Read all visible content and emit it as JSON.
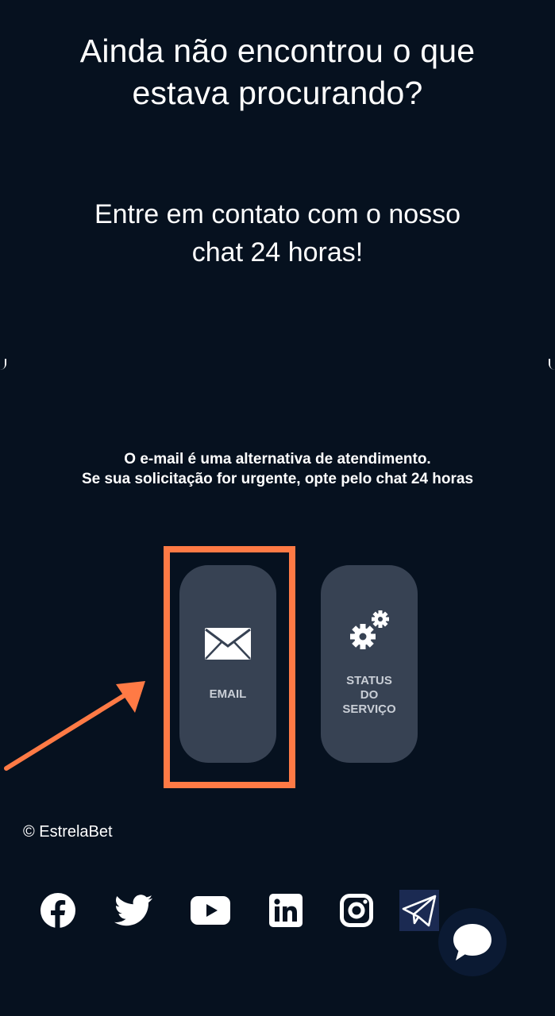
{
  "hero": {
    "title": "Ainda não encontrou o que estava procurando?",
    "subtitle": "Entre em contato com o nosso chat 24 horas!"
  },
  "notice": {
    "line1": "O e-mail é uma alternativa de atendimento.",
    "line2": "Se sua solicitação for urgente, opte pelo chat 24 horas"
  },
  "options": {
    "email": {
      "label": "EMAIL",
      "icon": "envelope-icon"
    },
    "status": {
      "label_line1": "STATUS",
      "label_line2": "DO",
      "label_line3": "SERVIÇO",
      "icon": "gears-icon"
    }
  },
  "footer": {
    "copyright": "© EstrelaBet",
    "social": [
      "facebook-icon",
      "twitter-icon",
      "youtube-icon",
      "linkedin-icon",
      "instagram-icon",
      "telegram-icon"
    ]
  },
  "chat": {
    "icon": "chat-bubble-icon"
  },
  "colors": {
    "background": "#06111f",
    "card": "#374253",
    "highlight": "#ff7a45",
    "card_label": "#c9ced6"
  }
}
